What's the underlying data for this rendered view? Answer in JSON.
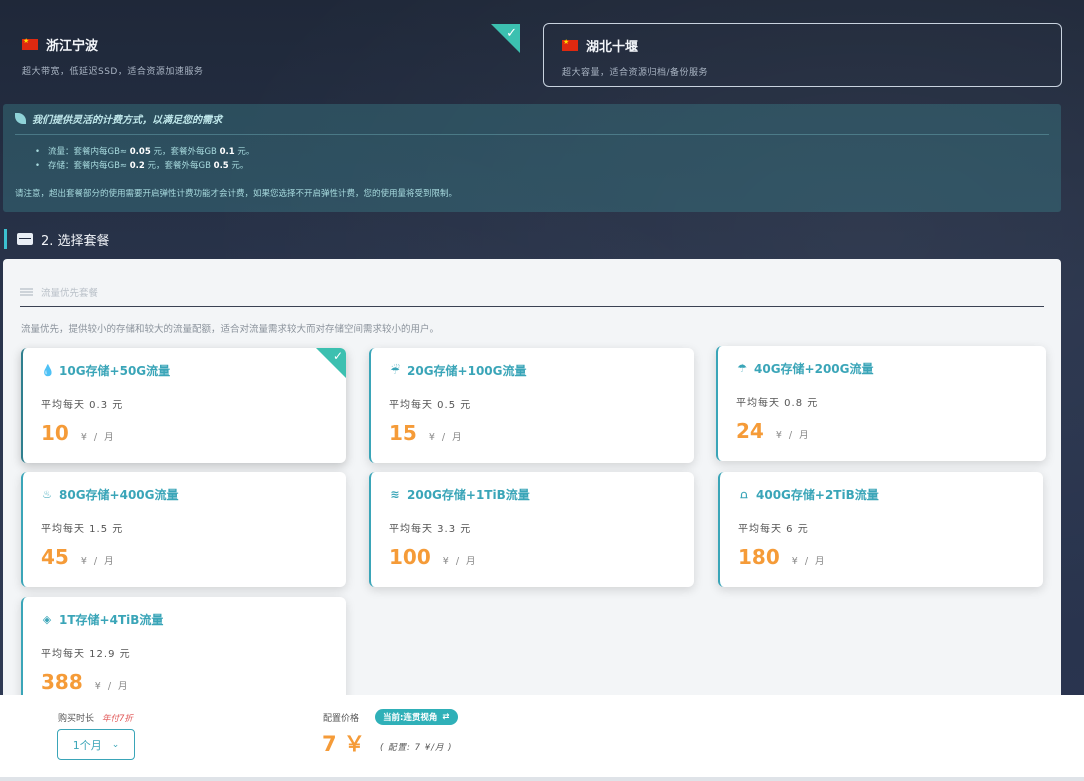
{
  "regions": [
    {
      "name": "浙江宁波",
      "desc": "超大带宽，低延迟SSD，适合资源加速服务",
      "selected": true
    },
    {
      "name": "湖北十堰",
      "desc": "超大容量，适合资源归档/备份服务",
      "selected": false
    }
  ],
  "billing": {
    "title": "我们提供灵活的计费方式，以满足您的需求",
    "traffic": {
      "label": "流量：套餐内每GB≈",
      "in_value": "0.05",
      "mid": "元，套餐外每GB",
      "out_value": "0.1",
      "unit": "元。"
    },
    "storage": {
      "label": "存储：套餐内每GB≈",
      "in_value": "0.2",
      "mid": "元，套餐外每GB",
      "out_value": "0.5",
      "unit": "元。"
    },
    "note": "请注意，超出套餐部分的使用需要开启弹性计费功能才会计费，如果您选择不开启弹性计费，您的使用量将受到限制。"
  },
  "section": {
    "title": "2. 选择套餐"
  },
  "panel": {
    "heading": "流量优先套餐",
    "desc": "流量优先，提供较小的存储和较大的流量配额，适合对流量需求较大而对存储空间需求较小的用户。"
  },
  "plans": [
    {
      "name": "10G存储+50G流量",
      "daily": "平均每天 0.3 元",
      "price": "10",
      "unit": "¥ / 月",
      "icon": "droplet-icon",
      "selected": true
    },
    {
      "name": "20G存储+100G流量",
      "daily": "平均每天 0.5 元",
      "price": "15",
      "unit": "¥ / 月",
      "icon": "cloud-rain-icon",
      "selected": false
    },
    {
      "name": "40G存储+200G流量",
      "daily": "平均每天 0.8 元",
      "price": "24",
      "unit": "¥ / 月",
      "icon": "cloud-showers-icon",
      "selected": false
    },
    {
      "name": "80G存储+400G流量",
      "daily": "平均每天 1.5 元",
      "price": "45",
      "unit": "¥ / 月",
      "icon": "pool-icon",
      "selected": false
    },
    {
      "name": "200G存储+1TiB流量",
      "daily": "平均每天 3.3 元",
      "price": "100",
      "unit": "¥ / 月",
      "icon": "water-icon",
      "selected": false
    },
    {
      "name": "400G存储+2TiB流量",
      "daily": "平均每天 6 元",
      "price": "180",
      "unit": "¥ / 月",
      "icon": "bridge-icon",
      "selected": false
    },
    {
      "name": "1T存储+4TiB流量",
      "daily": "平均每天 12.9 元",
      "price": "388",
      "unit": "¥ / 月",
      "icon": "cube-icon",
      "selected": false
    }
  ],
  "footer": {
    "duration_label": "购买时长",
    "duration_hint": "年付7折",
    "duration_value": "1个月",
    "price_label": "配置价格",
    "current_badge": "当前:连贯视角",
    "price": "7 ￥",
    "config": "( 配置: 7 ¥/月 )"
  },
  "colors": {
    "accent": "#3aa5b8",
    "price": "#f59b38",
    "check": "#3cc0b0"
  }
}
